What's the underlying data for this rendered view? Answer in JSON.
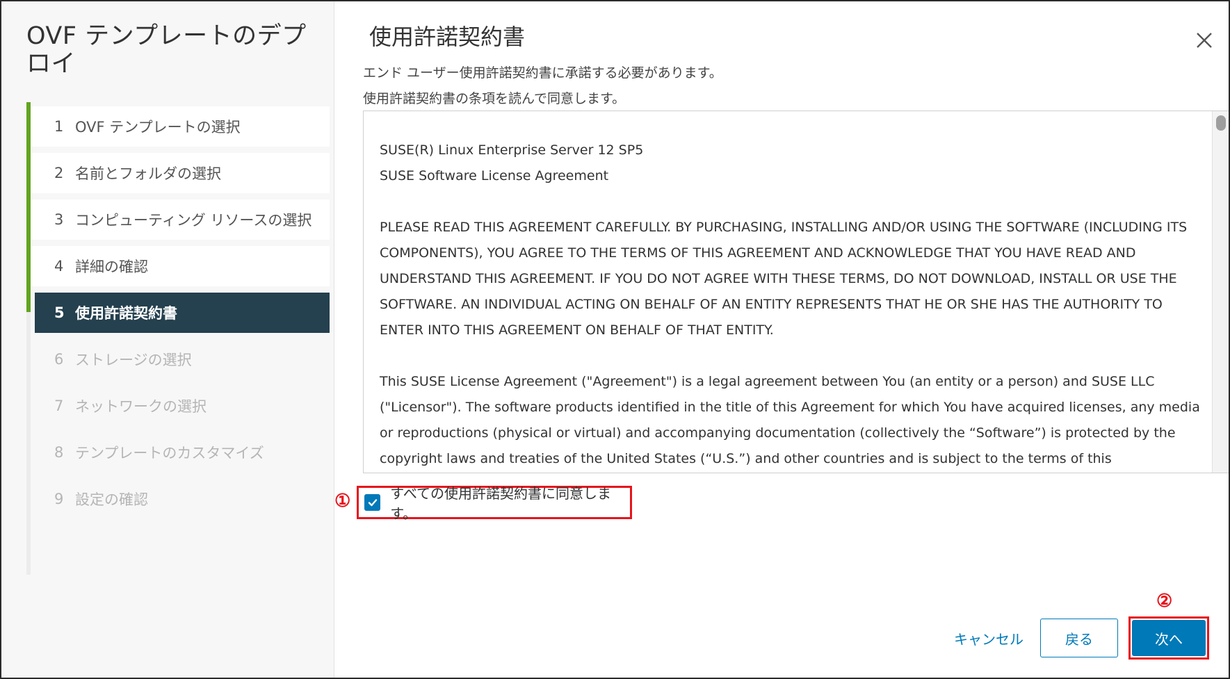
{
  "wizard": {
    "title": "OVF テンプレートのデプロイ",
    "steps": [
      {
        "num": "1",
        "label": "OVF テンプレートの選択",
        "state": "done"
      },
      {
        "num": "2",
        "label": "名前とフォルダの選択",
        "state": "done"
      },
      {
        "num": "3",
        "label": "コンピューティング リソースの選択",
        "state": "done"
      },
      {
        "num": "4",
        "label": "詳細の確認",
        "state": "done"
      },
      {
        "num": "5",
        "label": "使用許諾契約書",
        "state": "active"
      },
      {
        "num": "6",
        "label": "ストレージの選択",
        "state": "pending"
      },
      {
        "num": "7",
        "label": "ネットワークの選択",
        "state": "pending"
      },
      {
        "num": "8",
        "label": "テンプレートのカスタマイズ",
        "state": "pending"
      },
      {
        "num": "9",
        "label": "設定の確認",
        "state": "pending"
      }
    ]
  },
  "main": {
    "title": "使用許諾契約書",
    "intro_line1": "エンド ユーザー使用許諾契約書に承諾する必要があります。",
    "intro_line2": "使用許諾契約書の条項を読んで同意します。",
    "license": {
      "line1": "SUSE(R) Linux Enterprise Server 12 SP5",
      "line2": "SUSE Software License Agreement",
      "para1": "PLEASE READ THIS AGREEMENT CAREFULLY. BY PURCHASING, INSTALLING AND/OR USING THE SOFTWARE (INCLUDING ITS COMPONENTS), YOU AGREE TO THE TERMS OF THIS AGREEMENT AND ACKNOWLEDGE THAT YOU HAVE READ AND UNDERSTAND THIS AGREEMENT. IF YOU DO NOT AGREE WITH THESE TERMS, DO NOT DOWNLOAD, INSTALL OR USE THE SOFTWARE. AN INDIVIDUAL ACTING ON BEHALF OF AN ENTITY REPRESENTS THAT HE OR SHE HAS THE AUTHORITY TO ENTER INTO THIS AGREEMENT ON BEHALF OF THAT ENTITY.",
      "para2": "This SUSE License Agreement (\"Agreement\") is a legal agreement between You (an entity or a person) and SUSE LLC (\"Licensor\"). The software products identified in the title of this Agreement for which You have acquired licenses, any media or reproductions (physical or virtual) and accompanying documentation (collectively the “Software”) is protected by the copyright laws and treaties of the United States (“U.S.”) and other countries and is subject to the terms of this"
    },
    "agree_label": "すべての使用許諾契約書に同意します。",
    "agree_checked": true,
    "marker1": "①",
    "marker2": "②"
  },
  "footer": {
    "cancel_label": "キャンセル",
    "back_label": "戻る",
    "next_label": "次へ"
  },
  "colors": {
    "accent": "#0079b8",
    "active_step_bg": "#25404e",
    "done_rail": "#62a420",
    "highlight": "#e8141b"
  }
}
